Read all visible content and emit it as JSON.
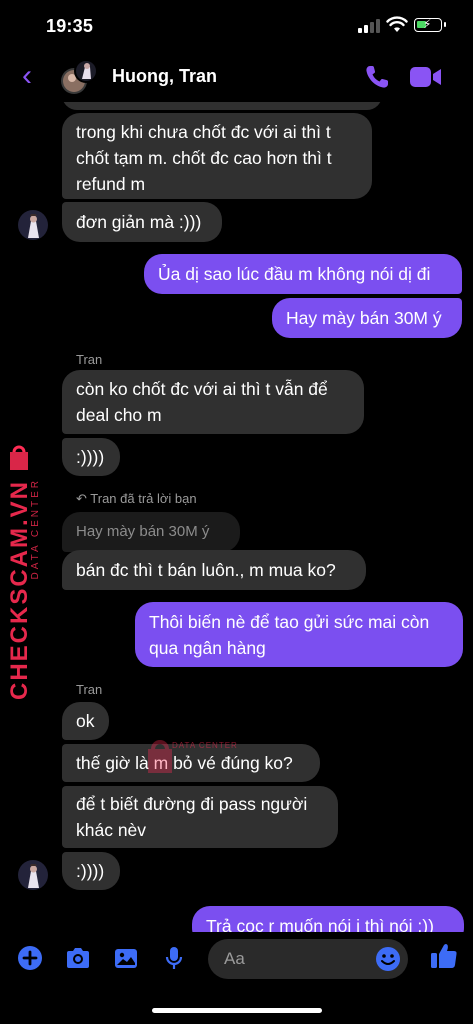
{
  "status_bar": {
    "time": "19:35"
  },
  "header": {
    "title": "Huong, Tran"
  },
  "messages": [
    {
      "text": "trong khi chưa chốt đc với ai thì t chốt tạm m. chốt đc cao hơn thì t refund m"
    },
    {
      "text": "đơn giản mà :)))"
    },
    {
      "text": "Ủa dị sao lúc đầu m không nói dị đi"
    },
    {
      "text": "Hay mày bán 30M ý"
    },
    {
      "sender": "Tran",
      "text": "còn ko chốt đc với ai thì t vẫn để deal cho m"
    },
    {
      "text": ":))))"
    },
    {
      "reply_note": "Tran đã trả lời bạn",
      "quoted": "Hay mày bán 30M ý",
      "text": "bán đc thì t bán luôn., m mua ko?"
    },
    {
      "text": "Thôi biến nè để tao gửi sức mai còn qua ngân hàng"
    },
    {
      "sender": "Tran",
      "text": "ok"
    },
    {
      "text": "thế giờ là m bỏ vé đúng ko?"
    },
    {
      "text": "để t biết đường đi pass người khác nèv"
    },
    {
      "text": ":))))"
    },
    {
      "text": "Trả cọc r muốn nói j thì nói :))"
    }
  ],
  "watermark": {
    "brand": "CHECKSCAM.VN",
    "tagline": "DATA CENTER"
  },
  "composer": {
    "placeholder": "Aa"
  },
  "colors": {
    "accent": "#8a54f4",
    "outgoing_bubble": "#7b4ff0",
    "incoming_bubble": "#303030",
    "watermark": "#ff2d55"
  }
}
